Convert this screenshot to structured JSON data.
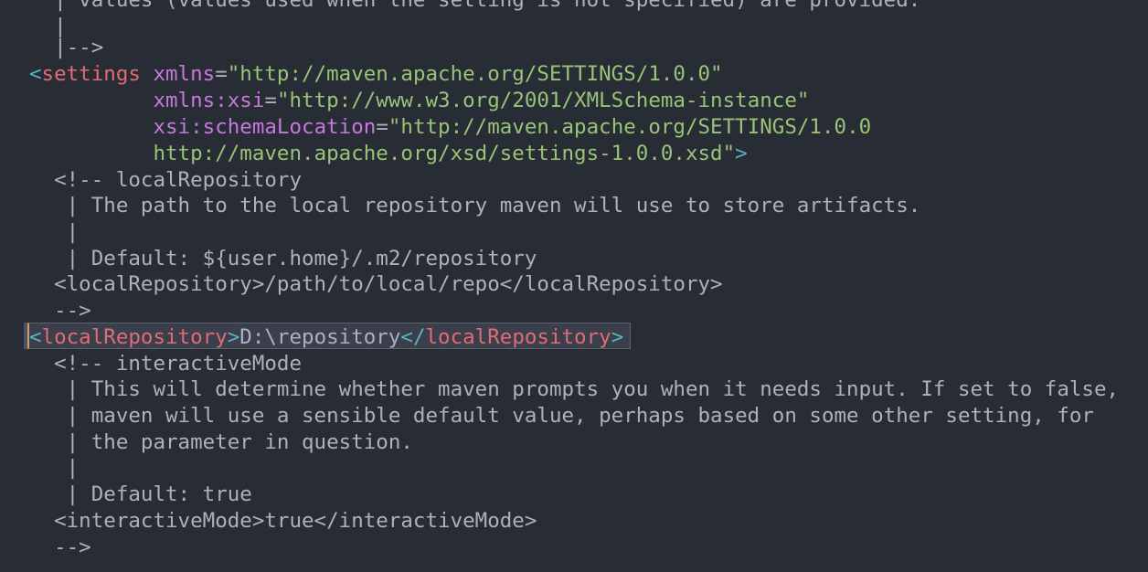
{
  "editor": {
    "lines": [
      "  | values (values used when the setting is not specified) are provided.",
      "  |",
      "  |-->",
      "",
      "",
      "",
      "",
      "  <!-- localRepository",
      "   | The path to the local repository maven will use to store artifacts.",
      "   |",
      "   | Default: ${user.home}/.m2/repository",
      "  <localRepository>/path/to/local/repo</localRepository>",
      "  -->",
      "",
      "  <!-- interactiveMode",
      "   | This will determine whether maven prompts you when it needs input. If set to false,",
      "   | maven will use a sensible default value, perhaps based on some other setting, for",
      "   | the parameter in question.",
      "   |",
      "   | Default: true",
      "  <interactiveMode>true</interactiveMode>",
      "  -->"
    ],
    "settings_tag": "settings",
    "xmlns_attr": "xmlns",
    "xmlns_value": "\"http://maven.apache.org/SETTINGS/1.0.0\"",
    "xmlns_xsi_attr": "xmlns:xsi",
    "xmlns_xsi_value": "\"http://www.w3.org/2001/XMLSchema-instance\"",
    "schema_attr": "xsi:schemaLocation",
    "schema_value_1": "\"http://maven.apache.org/SETTINGS/1.0.0",
    "schema_value_2": "http://maven.apache.org/xsd/settings-1.0.0.xsd\"",
    "local_repo_open": "localRepository",
    "local_repo_value": "D:\\repository",
    "local_repo_close": "localRepository"
  },
  "colors": {
    "background": "#282c34",
    "tag": "#e06c75",
    "punctuation": "#56b6c2",
    "attribute": "#c678dd",
    "string": "#98c379",
    "comment": "#abb2bf",
    "active_line_marker": "#d19a66"
  }
}
